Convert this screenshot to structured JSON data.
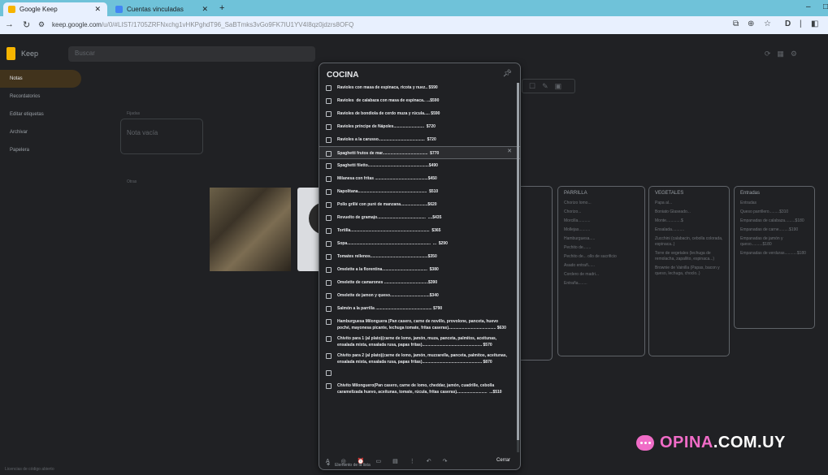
{
  "browser": {
    "tabs": [
      {
        "label": "Google Keep",
        "active": true,
        "icon_color": "#f6b400"
      },
      {
        "label": "Cuentas vinculadas",
        "active": false,
        "icon_color": "#4285f4"
      }
    ],
    "url_host": "keep.google.com",
    "url_path": "/u/0/#LIST/1705ZRFNxchg1vHKPghdT96_SaBTmks3vGo9FK7IU1YV4I8qz0jdzrs8OFQ",
    "icons": [
      "back-icon",
      "forward-icon",
      "reload-icon",
      "tune-icon",
      "zoom-icon",
      "star-icon",
      "extensions-icon",
      "profile-icon",
      "menu-icon"
    ]
  },
  "keep": {
    "app_name": "Keep",
    "search_placeholder": "Buscar",
    "sidebar": [
      "Notas",
      "Recordatorios",
      "Editar etiquetas",
      "Archivar",
      "Papelera"
    ],
    "fixed_label": "Fijadas",
    "other_label": "Otras",
    "empty_note": "Nota vacía",
    "footer_note": "Licencias de código abierto"
  },
  "note": {
    "title": "COCINA",
    "items": [
      "Ravioles con masa de espinaca, ricota y nuez.. $590",
      "Ravioles  de calabaza con masa de espinaca.. ...$590",
      "Ravioles de bondiola de cerdo muza y rúcula..... $590",
      "Ravioles príncipe de Nápoles...........................  $720",
      "Ravioles a la carusso.........................................  $720",
      "Spaghetti frutos de mar........................................  $770",
      "Spaghetti filetto......................................................$490",
      "Milanesa con fritas ...............................................$450",
      "Napolitana.............................................................  $510",
      "Pollo grillé con puré de manzana........................$620",
      "Revuelto de gramajo...........................................  ....$435",
      "Tortilla......................................................................  $365",
      "Sopa..........................................................................  ...  $290",
      "Tomates rellenos...................................................$350",
      "Omelette a la florentina........................................  $380",
      "Omelette de camarones .......................................$390",
      "Omelette de jamon y queso...................................$340",
      "Salmón a la parrilla .................................................. $790",
      "Hamburguesa Milonguera (Pan casero, carne de novillo, provolone, panceta, huevo poché, mayonesa picante, lechuga tomate, fritas caseras).......................................... $630",
      "Chivito para 1 (al plato)(carne de lomo, jamón, muza, panceta, palmitos, aceitunas, ensalada mixta, ensalada rusa, papas fritas)..................................................... $570",
      "Chivito para 2 (al plato)(carne de lomo, jamón, muzzarella, panceta, palmitos, aceitunas, ensalada mixta, ensalada rusa, papas fritas)..................................................... $870",
      "",
      "Chivito Milonguero(Pan casero, carne de lomo, cheddar, jamón, cuadrille, cebolla caramelizada huevo, aceitunas, tomate, rúcula, fritas caseras)...........................  ...$510"
    ],
    "highlight_index": 5,
    "add_item_label": "Elemento de la lista",
    "close_label": "Cerrar",
    "toolbar_icons": [
      "format-icon",
      "palette-icon",
      "reminder-icon",
      "image-icon",
      "archive-icon",
      "more-icon",
      "undo-icon",
      "redo-icon"
    ]
  },
  "background_lists": [
    {
      "title": "PARRILLA",
      "items": [
        "Chorizo lomo...",
        "Chorizo...",
        "Morcilla...........",
        "Mollejas..........",
        "Hamburguesa.....",
        "Pechito de.......",
        "Pechito de... ollo de sacrificio",
        "Asado entrañ......",
        "Cordero de madri...",
        "Entraña........"
      ]
    },
    {
      "title": "VEGETALES",
      "items": [
        "Papa al...",
        "Boniato Glaseado...",
        "Monte.............$",
        "Ensalada...........",
        "Zucchini (calabacin, cebolla colorada, espinaca..)",
        "Torre de vegetales (lechuga de remolacha, zapallito, espinaca...)",
        "Brownie de Vainilla (Papas, bacon y queso, lechuga, choclo..)"
      ]
    },
    {
      "title": "Entradas",
      "items": [
        "Entradas",
        "Queso parrillero.........$310",
        "Empanadas de calabaza.........$180",
        "Empanadas de carne.........$190",
        "Empanadas de jamón y queso..........$180",
        "Empanadas de verduras...........$180"
      ]
    }
  ],
  "watermark": {
    "part1": "OPINA",
    "part2": ".COM.UY"
  },
  "colors": {
    "keep_yellow": "#f6b400",
    "watermark_pink": "#f06cc7",
    "chrome_cyan": "#6fc2d9"
  }
}
